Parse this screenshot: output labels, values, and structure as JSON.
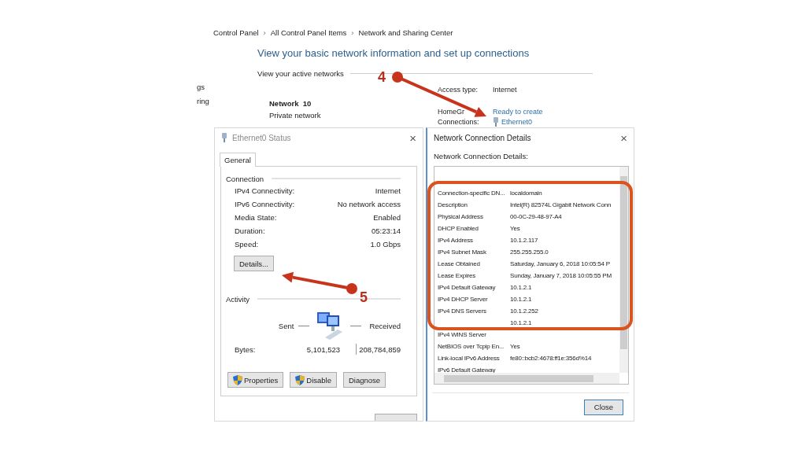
{
  "breadcrumb": {
    "separator": "›",
    "items": [
      "Control Panel",
      "All Control Panel Items",
      "Network and Sharing Center"
    ]
  },
  "heading": "View your basic network information and set up connections",
  "active_networks_label": "View your active networks",
  "sidebar_fragments": [
    "gs",
    "ring"
  ],
  "network": {
    "name": "Network  10",
    "type": "Private network"
  },
  "network_info": [
    {
      "label": "Access type:",
      "value": "Internet",
      "kind": "text"
    },
    {
      "label": "HomeGr",
      "value": "Ready to create",
      "kind": "link"
    },
    {
      "label": "Connections:",
      "value": "Ethernet0",
      "kind": "connection"
    }
  ],
  "status_dialog": {
    "title": "Ethernet0 Status",
    "close": "×",
    "tabs": [
      {
        "label": "General",
        "selected": true
      }
    ],
    "connection_label": "Connection",
    "connection_rows": [
      {
        "label": "IPv4 Connectivity:",
        "value": "Internet"
      },
      {
        "label": "IPv6 Connectivity:",
        "value": "No network access"
      },
      {
        "label": "Media State:",
        "value": "Enabled"
      },
      {
        "label": "Duration:",
        "value": "05:23:14"
      },
      {
        "label": "Speed:",
        "value": "1.0 Gbps"
      }
    ],
    "details_button": "Details...",
    "activity_label": "Activity",
    "sent_label": "Sent",
    "received_label": "Received",
    "bytes_label": "Bytes:",
    "bytes_sent": "5,101,523",
    "bytes_received": "208,784,859",
    "buttons": [
      {
        "label": "Properties",
        "kind": "shield"
      },
      {
        "label": "Disable",
        "kind": "shield"
      },
      {
        "label": "Diagnose",
        "kind": "plain"
      }
    ]
  },
  "details_dialog": {
    "title": "Network Connection Details",
    "close": "×",
    "list_label": "Network Connection Details:",
    "rows": [
      {
        "property": "Connection-specific DN...",
        "value": "localdomain"
      },
      {
        "property": "Description",
        "value": "Intel(R) 82574L Gigabit Network Conn"
      },
      {
        "property": "Physical Address",
        "value": "00-0C-29-48-97-A4"
      },
      {
        "property": "DHCP Enabled",
        "value": "Yes"
      },
      {
        "property": "IPv4 Address",
        "value": "10.1.2.117"
      },
      {
        "property": "IPv4 Subnet Mask",
        "value": "255.255.255.0"
      },
      {
        "property": "Lease Obtained",
        "value": "Saturday, January 6, 2018 10:05:54 P"
      },
      {
        "property": "Lease Expires",
        "value": "Sunday, January 7, 2018 10:05:55 PM"
      },
      {
        "property": "IPv4 Default Gateway",
        "value": "10.1.2.1"
      },
      {
        "property": "IPv4 DHCP Server",
        "value": "10.1.2.1"
      },
      {
        "property": "IPv4 DNS Servers",
        "value": "10.1.2.252"
      },
      {
        "value": "10.1.2.1"
      },
      {
        "property": "IPv4 WINS Server"
      },
      {
        "property": "NetBIOS over Tcpip En...",
        "value": "Yes"
      },
      {
        "property": "Link-local IPv6 Address",
        "value": "fe80::bcb2:4678:ff1e:356d%14"
      },
      {
        "property": "IPv6 Default Gateway"
      }
    ],
    "close_button": "Close"
  },
  "annotations": [
    {
      "number": "4"
    },
    {
      "number": "5"
    }
  ]
}
